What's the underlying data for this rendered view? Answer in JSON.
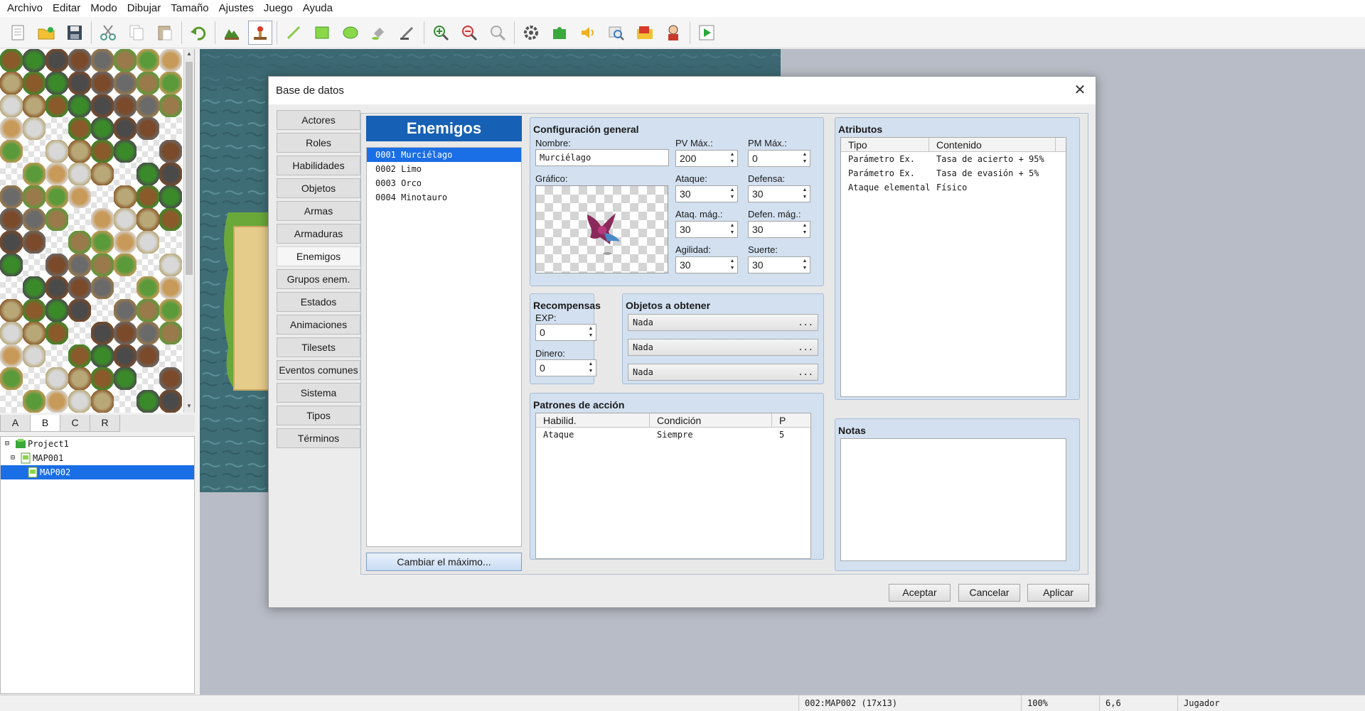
{
  "menu": [
    "Archivo",
    "Editar",
    "Modo",
    "Dibujar",
    "Tamaño",
    "Ajustes",
    "Juego",
    "Ayuda"
  ],
  "toolbar_icons": [
    "new-project-icon",
    "open-project-icon",
    "save-project-icon",
    "cut-icon",
    "copy-icon",
    "paste-icon",
    "undo-icon",
    "map-mode-icon",
    "event-mode-icon",
    "pencil-icon",
    "rectangle-icon",
    "ellipse-icon",
    "fill-icon",
    "shadow-pen-icon",
    "zoom-in-icon",
    "zoom-out-icon",
    "zoom-actual-icon",
    "database-icon",
    "plugin-manager-icon",
    "sound-test-icon",
    "event-searcher-icon",
    "resource-manager-icon",
    "character-generator-icon",
    "playtest-icon"
  ],
  "tile_tabs": [
    "A",
    "B",
    "C",
    "R"
  ],
  "tile_tab_selected": "B",
  "map_tree": [
    {
      "label": "Project1",
      "icon": "project-icon"
    },
    {
      "label": "MAP001",
      "icon": "map-icon"
    },
    {
      "label": "MAP002",
      "icon": "map-icon"
    }
  ],
  "status": {
    "map": "002:MAP002 (17x13)",
    "zoom": "100%",
    "coords": "6,6",
    "mode": "Jugador"
  },
  "dialog": {
    "title": "Base de datos",
    "categories": [
      "Actores",
      "Roles",
      "Habilidades",
      "Objetos",
      "Armas",
      "Armaduras",
      "Enemigos",
      "Grupos enem.",
      "Estados",
      "Animaciones",
      "Tilesets",
      "Eventos comunes",
      "Sistema",
      "Tipos",
      "Términos"
    ],
    "selected_category": "Enemigos",
    "list_title": "Enemigos",
    "enemies": [
      "0001 Murciélago",
      "0002 Limo",
      "0003 Orco",
      "0004 Minotauro"
    ],
    "change_max": "Cambiar el máximo...",
    "general": {
      "title": "Configuración general",
      "name_label": "Nombre:",
      "name_value": "Murciélago",
      "graphic_label": "Gráfico:",
      "params": [
        {
          "label": "PV Máx.:",
          "value": "200"
        },
        {
          "label": "PM Máx.:",
          "value": "0"
        },
        {
          "label": "Ataque:",
          "value": "30"
        },
        {
          "label": "Defensa:",
          "value": "30"
        },
        {
          "label": "Ataq. mág.:",
          "value": "30"
        },
        {
          "label": "Defen. mág.:",
          "value": "30"
        },
        {
          "label": "Agilidad:",
          "value": "30"
        },
        {
          "label": "Suerte:",
          "value": "30"
        }
      ]
    },
    "rewards": {
      "title": "Recompensas",
      "exp_label": "EXP:",
      "exp_value": "0",
      "gold_label": "Dinero:",
      "gold_value": "0"
    },
    "drops": {
      "title": "Objetos a obtener",
      "items": [
        "Nada",
        "Nada",
        "Nada"
      ],
      "more": "..."
    },
    "actions": {
      "title": "Patrones de acción",
      "columns": [
        "Habilid.",
        "Condición",
        "P"
      ],
      "rows": [
        {
          "skill": "Ataque",
          "condition": "Siempre",
          "priority": "5"
        }
      ]
    },
    "traits": {
      "title": "Atributos",
      "columns": [
        "Tipo",
        "Contenido"
      ],
      "rows": [
        {
          "type": "Parámetro Ex.",
          "content": "Tasa de acierto + 95%"
        },
        {
          "type": "Parámetro Ex.",
          "content": "Tasa de evasión + 5%"
        },
        {
          "type": "Ataque elemental",
          "content": "Físico"
        }
      ]
    },
    "notes": {
      "title": "Notas",
      "value": ""
    },
    "buttons": {
      "ok": "Aceptar",
      "cancel": "Cancelar",
      "apply": "Aplicar"
    }
  },
  "colors": {
    "selection": "#1a6ee6",
    "list_header": "#1660b5",
    "group_bg": "#d2e0f0"
  }
}
